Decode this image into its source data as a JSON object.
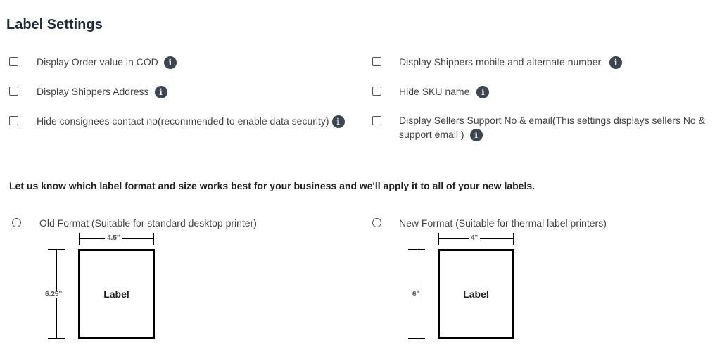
{
  "page": {
    "title": "Label Settings"
  },
  "settings": {
    "left": [
      {
        "label": "Display Order value in COD"
      },
      {
        "label": "Display Shippers Address"
      },
      {
        "label": "Hide consignees contact no(recommended to enable data security)"
      }
    ],
    "right": [
      {
        "label": "Display Shippers mobile and alternate number"
      },
      {
        "label": "Hide SKU name"
      },
      {
        "label": "Display Sellers Support No & email(This settings displays sellers No & support email )"
      }
    ],
    "info_glyph": "i",
    "info_icon": "info-icon"
  },
  "format": {
    "question": "Let us know which label format and size works best for your business and we'll apply it to all of your new labels.",
    "old": {
      "label": "Old Format (Suitable for standard desktop printer)",
      "width": "4.5\"",
      "height": "6.25\"",
      "box_text": "Label"
    },
    "new": {
      "label": "New Format (Suitable for thermal label printers)",
      "width": "4\"",
      "height": "6\"",
      "box_text": "Label"
    }
  }
}
